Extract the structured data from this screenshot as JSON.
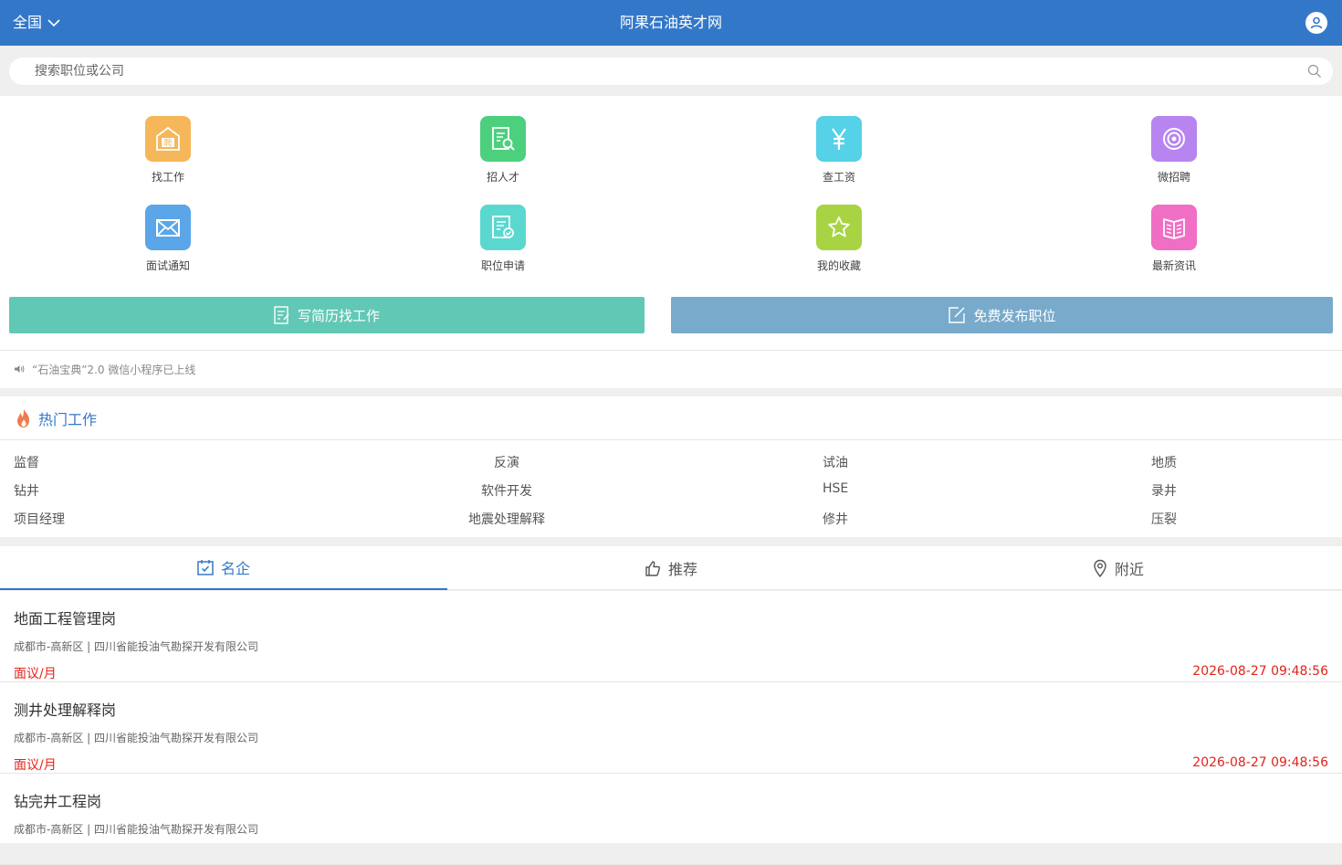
{
  "header": {
    "region": "全国",
    "title": "阿果石油英才网"
  },
  "search": {
    "placeholder": "搜索职位或公司"
  },
  "menu": [
    {
      "label": "找工作",
      "icon": "recruit-icon",
      "color": "#f5b75a"
    },
    {
      "label": "招人才",
      "icon": "resume-search-icon",
      "color": "#4dd07e"
    },
    {
      "label": "查工资",
      "icon": "yen-icon",
      "color": "#55d1e8"
    },
    {
      "label": "微招聘",
      "icon": "target-icon",
      "color": "#b784f0"
    },
    {
      "label": "面试通知",
      "icon": "mail-icon",
      "color": "#5aa6e8"
    },
    {
      "label": "职位申请",
      "icon": "application-icon",
      "color": "#5ad8d0"
    },
    {
      "label": "我的收藏",
      "icon": "star-icon",
      "color": "#a8d444"
    },
    {
      "label": "最新资讯",
      "icon": "news-book-icon",
      "color": "#f06fc4"
    }
  ],
  "actions": {
    "resume": {
      "label": "写简历找工作",
      "color": "#62c8b6"
    },
    "post": {
      "label": "免费发布职位",
      "color": "#78aacb"
    }
  },
  "notice": {
    "text": "“石油宝典”2.0 微信小程序已上线"
  },
  "hot": {
    "title": "热门工作",
    "items": [
      "监督",
      "反演",
      "试油",
      "地质",
      "钻井",
      "软件开发",
      "HSE",
      "录井",
      "项目经理",
      "地震处理解释",
      "修井",
      "压裂"
    ]
  },
  "tabs": [
    {
      "label": "名企",
      "icon": "calendar-check-icon"
    },
    {
      "label": "推荐",
      "icon": "thumbs-up-icon"
    },
    {
      "label": "附近",
      "icon": "location-pin-icon"
    }
  ],
  "jobs": [
    {
      "title": "地面工程管理岗",
      "meta": "成都市-高新区 | 四川省能投油气勘探开发有限公司",
      "salary": "面议/月",
      "time": "2026-08-27 09:48:56"
    },
    {
      "title": "测井处理解释岗",
      "meta": "成都市-高新区 | 四川省能投油气勘探开发有限公司",
      "salary": "面议/月",
      "time": "2026-08-27 09:48:56"
    },
    {
      "title": "钻完井工程岗",
      "meta": "成都市-高新区 | 四川省能投油气勘探开发有限公司",
      "salary": "",
      "time": ""
    }
  ]
}
